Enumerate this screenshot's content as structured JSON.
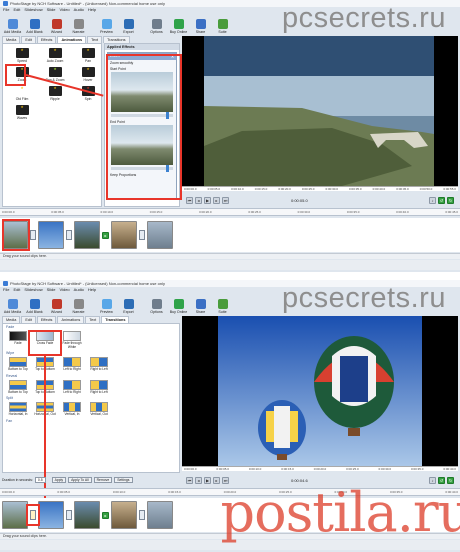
{
  "watermark": "pcsecrets.ru",
  "colors": {
    "accent": "#e8352a",
    "window": "#dfe6ee",
    "green": "#36a041"
  },
  "top": {
    "title": "PhotoStage by NCH Software - Untitled* - (Unlicensed) Non-commercial home use only",
    "menu": [
      "File",
      "Edit",
      "Slideshow",
      "Slide",
      "Video",
      "Audio",
      "Help"
    ],
    "toolbar": [
      "Add Media",
      "Add Blank",
      "Wizard",
      "Narrate",
      "Preview",
      "Export",
      "Options",
      "Buy Online",
      "Share",
      "Suite"
    ],
    "tabs": [
      "Media",
      "Edit",
      "Effects",
      "Animations",
      "Text",
      "Transitions"
    ],
    "active_tab": "Animations",
    "effects": [
      "Speed",
      "Auto Zoom",
      "Pan",
      "Zoom",
      "Pan & Zoom",
      "Hover",
      "Old Film",
      "Ripple",
      "Spin",
      "Waves"
    ],
    "applied_effects": {
      "title": "Applied Effects",
      "effect": "Zoom",
      "zoom_smoothly": "Zoom smoothly",
      "start_point": "Start Point",
      "end_point": "End Point",
      "keep_proportions": "Keep Proportions"
    },
    "ruler": [
      "0:00:00.0",
      "0:00:05.0",
      "0:00:10.0",
      "0:00:15.0",
      "0:00:20.0",
      "0:00:25.0",
      "0:00:30.0",
      "0:00:35.0",
      "0:00:40.0",
      "0:00:45.0",
      "0:00:50.0",
      "0:00:55.0"
    ],
    "time": "0:00:05.0",
    "tl_ruler": [
      "0:00:00.0",
      "0:00:05.0",
      "0:00:10.0",
      "0:00:15.0",
      "0:00:20.0",
      "0:00:25.0",
      "0:00:30.0",
      "0:00:35.0",
      "0:00:40.0",
      "0:00:45.0"
    ],
    "audio": "Drag your sound clips here."
  },
  "bottom": {
    "title": "PhotoStage by NCH Software - Untitled* - (Unlicensed) Non-commercial home use only",
    "menu": [
      "File",
      "Edit",
      "Slideshow",
      "Slide",
      "Video",
      "Audio",
      "Help"
    ],
    "toolbar": [
      "Add Media",
      "Add Blank",
      "Wizard",
      "Narrate",
      "Preview",
      "Export",
      "Options",
      "Buy Online",
      "Share",
      "Suite"
    ],
    "tabs": [
      "Media",
      "Edit",
      "Effects",
      "Animations",
      "Text",
      "Transitions"
    ],
    "active_tab": "Transitions",
    "sections": [
      {
        "name": "Fade",
        "items": [
          "Fade",
          "Cross Fade",
          "Fade through White"
        ]
      },
      {
        "name": "Wipe",
        "items": [
          "Bottom to Top",
          "Top to Bottom",
          "Left to Right",
          "Right to Left"
        ]
      },
      {
        "name": "Reveal",
        "items": [
          "Bottom to Top",
          "Top to Bottom",
          "Left to Right",
          "Right to Left"
        ]
      },
      {
        "name": "Split",
        "items": [
          "Horizontal, In",
          "Horizontal, Out",
          "Vertical, In",
          "Vertical, Out"
        ]
      },
      {
        "name": "Fan",
        "items": []
      }
    ],
    "duration_label": "Duration in seconds:",
    "duration_value": "0.5",
    "buttons": [
      "Apply",
      "Apply To All",
      "Remove",
      "Settings"
    ],
    "ruler": [
      "0:00:00.0",
      "0:00:05.0",
      "0:00:10.0",
      "0:00:15.0",
      "0:00:20.0",
      "0:00:25.0",
      "0:00:30.0",
      "0:00:35.0",
      "0:00:40.0"
    ],
    "time": "0:00:04.6",
    "audio": "Drag your sound clips here."
  }
}
